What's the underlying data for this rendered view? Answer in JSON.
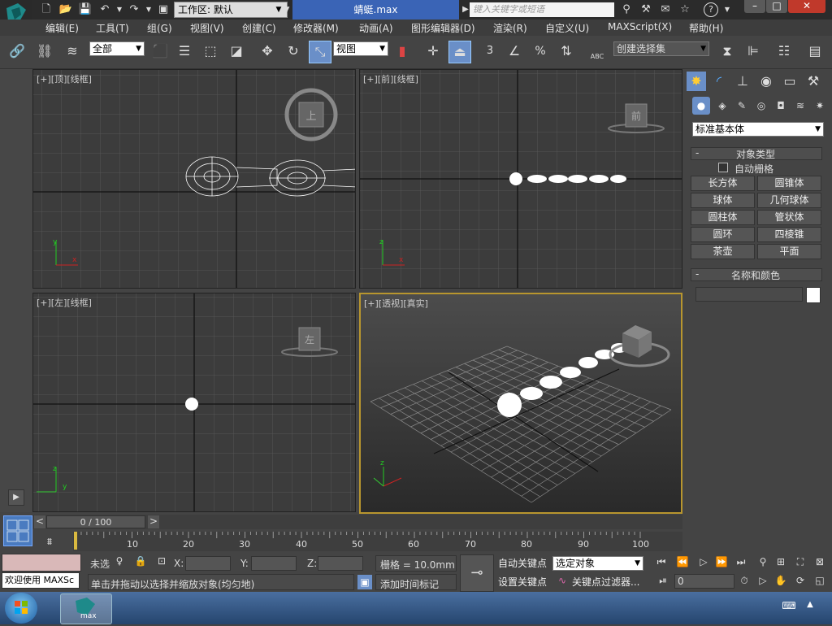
{
  "titlebar": {
    "workspace_label": "工作区: 默认",
    "file_title": "蜻蜓.max",
    "search_placeholder": "键入关键字或短语",
    "logo_text": "max"
  },
  "menus": [
    "编辑(E)",
    "工具(T)",
    "组(G)",
    "视图(V)",
    "创建(C)",
    "修改器(M)",
    "动画(A)",
    "图形编辑器(D)",
    "渲染(R)",
    "自定义(U)",
    "MAXScript(X)",
    "帮助(H)"
  ],
  "toolbar": {
    "filter_select": "全部",
    "refcoord_select": "视图",
    "named_selection": "创建选择集",
    "snap_label": "3",
    "percent_label": "%",
    "abc_label": "ABC"
  },
  "viewports": {
    "top": {
      "label": "[+][顶][线框]",
      "cube": "上"
    },
    "front": {
      "label": "[+][前][线框]",
      "cube": "前"
    },
    "left": {
      "label": "[+][左][线框]",
      "cube": "左"
    },
    "persp": {
      "label": "[+][透视][真实]"
    }
  },
  "axes": {
    "x": "x",
    "y": "y",
    "z": "z"
  },
  "command_panel": {
    "dropdown": "标准基本体",
    "object_type_header": "对象类型",
    "auto_grid": "自动栅格",
    "buttons": [
      "长方体",
      "圆锥体",
      "球体",
      "几何球体",
      "圆柱体",
      "管状体",
      "圆环",
      "四棱锥",
      "茶壶",
      "平面"
    ],
    "name_color_header": "名称和颜色",
    "rollout_toggle": "-"
  },
  "timeline": {
    "frame_counter": "0 / 100",
    "ticks": [
      "10",
      "20",
      "30",
      "40",
      "50",
      "60",
      "70",
      "80",
      "90",
      "100"
    ],
    "prev": "<",
    "next": ">"
  },
  "status": {
    "welcome": "欢迎使用 MAXSc",
    "unselected": "未选",
    "x_label": "X:",
    "y_label": "Y:",
    "z_label": "Z:",
    "grid": "栅格 = 10.0mm",
    "prompt": "单击并拖动以选择并缩放对象(均匀地)",
    "add_time_tag": "添加时间标记",
    "auto_key": "自动关键点",
    "set_key": "设置关键点",
    "key_mode_select": "选定对象",
    "key_filters": "关键点过滤器...",
    "frame_field": "0"
  }
}
